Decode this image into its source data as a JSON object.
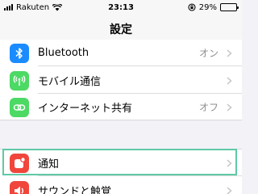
{
  "status_bar": {
    "carrier": "Rakuten",
    "time": "23:13",
    "battery_percent": "29%",
    "battery_level": 0.29
  },
  "nav": {
    "title": "設定"
  },
  "settings_group_1": [
    {
      "label": "Bluetooth",
      "value": "オン",
      "icon": "bluetooth-icon",
      "color": "#1a8cff"
    },
    {
      "label": "モバイル通信",
      "value": "",
      "icon": "antenna-icon",
      "color": "#4cd964"
    },
    {
      "label": "インターネット共有",
      "value": "オフ",
      "icon": "link-icon",
      "color": "#4cd964"
    }
  ],
  "settings_group_2": [
    {
      "label": "通知",
      "value": "",
      "icon": "notifications-icon",
      "color": "#f0463c"
    },
    {
      "label": "サウンドと触覚",
      "value": "",
      "icon": "sound-icon",
      "color": "#f0463c"
    }
  ],
  "colors": {
    "highlight": "#5fc9a5"
  }
}
